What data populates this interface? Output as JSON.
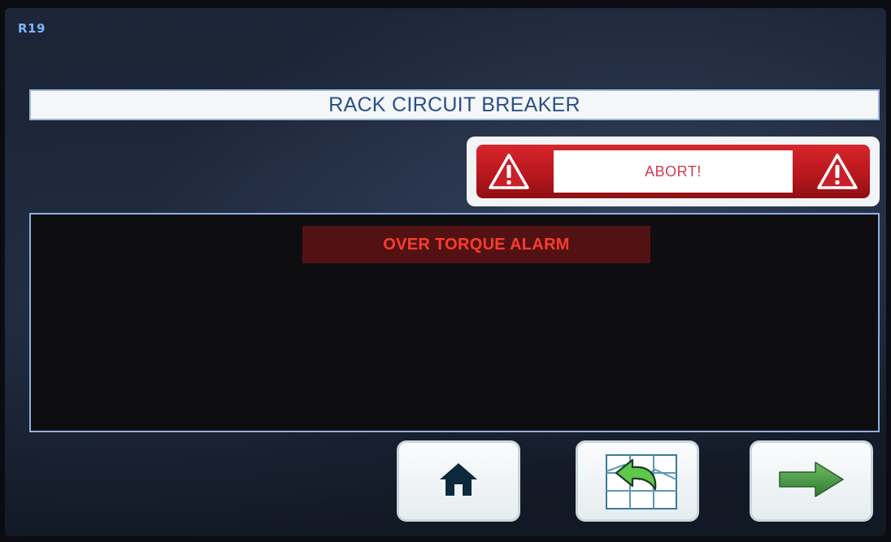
{
  "screen": {
    "id": "R19"
  },
  "header": {
    "title": "RACK CIRCUIT BREAKER"
  },
  "status": {
    "label": "ABORT!",
    "left_icon": "warning-triangle-icon",
    "right_icon": "warning-triangle-icon",
    "color": "#d0222a"
  },
  "message": {
    "alarm": "OVER TORQUE ALARM",
    "color": "#ff3b2c"
  },
  "nav": {
    "home_icon": "home-icon",
    "back_icon": "back-to-menu-icon",
    "next_icon": "right-arrow-icon"
  }
}
